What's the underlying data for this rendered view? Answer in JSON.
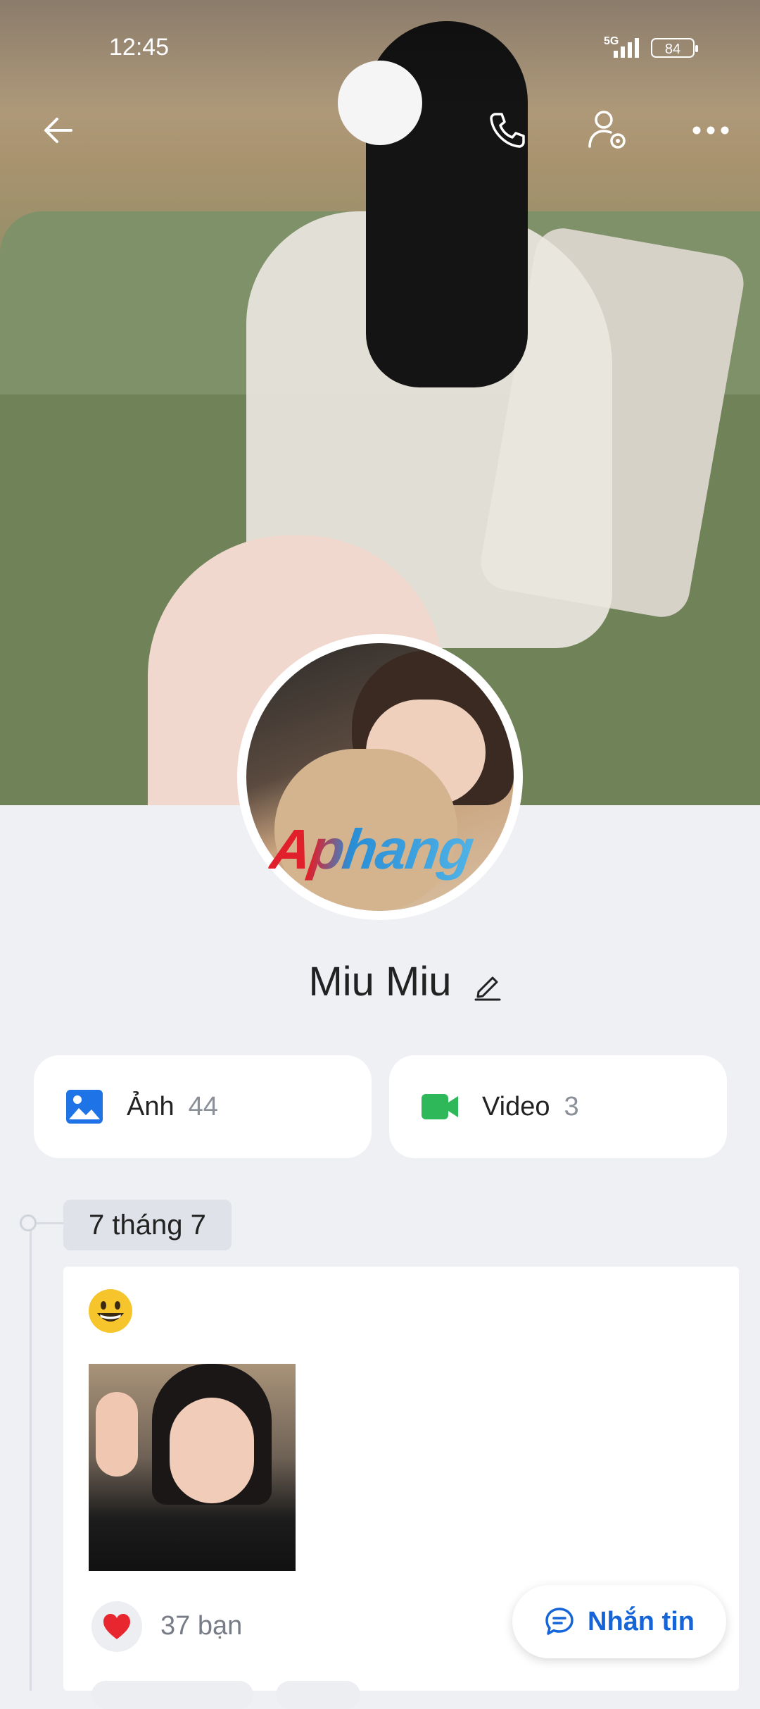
{
  "status_bar": {
    "time": "12:45",
    "network": "5G",
    "battery": "84"
  },
  "header": {
    "back_icon": "arrow-left-icon",
    "call_icon": "phone-icon",
    "settings_icon": "user-settings-icon",
    "more_icon": "more-dots-icon"
  },
  "profile": {
    "name": "Miu Miu",
    "watermark": "Aphang"
  },
  "media": {
    "photos_label": "Ảnh",
    "photos_count": "44",
    "video_label": "Video",
    "video_count": "3"
  },
  "timeline": {
    "date": "7 tháng 7",
    "post": {
      "emoji": "😀",
      "reaction_count": "37 bạn"
    }
  },
  "actions": {
    "message_label": "Nhắn tin"
  },
  "colors": {
    "accent": "#1565d8",
    "photo_icon": "#1e74e6",
    "video_icon": "#2fb85a",
    "background": "#eef0f4"
  }
}
